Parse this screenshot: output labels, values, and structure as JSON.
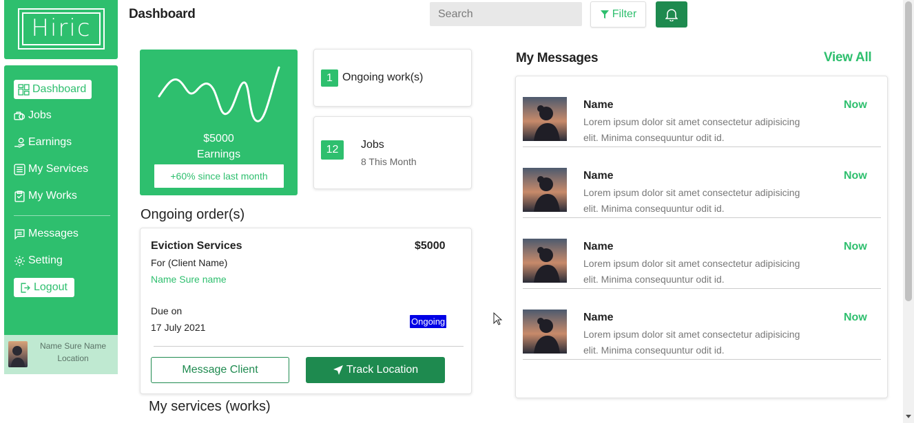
{
  "brand": {
    "logo_text": "Hiric"
  },
  "sidebar": {
    "items": [
      {
        "label": "Dashboard",
        "icon": "dashboard-icon"
      },
      {
        "label": "Jobs",
        "icon": "jobs-icon"
      },
      {
        "label": "Earnings",
        "icon": "earnings-icon"
      },
      {
        "label": "My Services",
        "icon": "services-icon"
      },
      {
        "label": "My Works",
        "icon": "works-icon"
      },
      {
        "label": "Messages",
        "icon": "messages-icon"
      },
      {
        "label": "Setting",
        "icon": "gear-icon"
      },
      {
        "label": "Logout",
        "icon": "logout-icon"
      }
    ],
    "active": "Dashboard",
    "profile": {
      "name": "Name Sure Name",
      "location": "Location"
    }
  },
  "header": {
    "title": "Dashboard",
    "search_placeholder": "Search",
    "filter_label": "Filter"
  },
  "earnings_card": {
    "amount": "$5000",
    "label": "Earnings",
    "growth": "+60% since last month"
  },
  "stats": [
    {
      "count": "1",
      "label": "Ongoing work(s)",
      "sub": ""
    },
    {
      "count": "12",
      "label": "Jobs",
      "sub": "8 This Month"
    }
  ],
  "orders": {
    "title": "Ongoing order(s)",
    "items": [
      {
        "service": "Eviction Services",
        "price": "$5000",
        "for_label": "For (Client Name)",
        "client_name": "Name Sure name",
        "due_label": "Due on",
        "due_date": "17 July 2021",
        "status": "Ongoing",
        "message_button": "Message Client",
        "track_button": "Track Location"
      }
    ]
  },
  "services_title": "My services (works)",
  "messages": {
    "title": "My Messages",
    "view_all": "View All",
    "items": [
      {
        "name": "Name",
        "time": "Now",
        "body": "Lorem ipsum dolor sit amet consectetur adipisicing elit. Minima consequuntur odit id."
      },
      {
        "name": "Name",
        "time": "Now",
        "body": "Lorem ipsum dolor sit amet consectetur adipisicing elit. Minima consequuntur odit id."
      },
      {
        "name": "Name",
        "time": "Now",
        "body": "Lorem ipsum dolor sit amet consectetur adipisicing elit. Minima consequuntur odit id."
      },
      {
        "name": "Name",
        "time": "Now",
        "body": "Lorem ipsum dolor sit amet consectetur adipisicing elit. Minima consequuntur odit id."
      }
    ]
  },
  "colors": {
    "primary": "#2ebf6e",
    "primary_dark": "#1e8a4f",
    "status_ongoing": "#0000e6",
    "profile_bg": "#bfe9d1"
  }
}
